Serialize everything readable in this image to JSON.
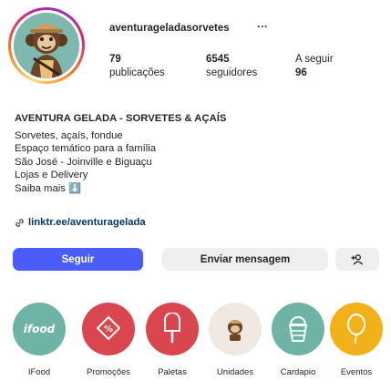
{
  "profile": {
    "username": "aventurageladasorvetes",
    "more_icon": "more-horizontal-icon",
    "stats": {
      "posts": {
        "value": "79",
        "label": "publicações"
      },
      "followers": {
        "value": "6545",
        "label": "seguidores"
      },
      "following": {
        "label": "A seguir",
        "value": "96"
      }
    }
  },
  "bio": {
    "name": "AVENTURA GELADA - SORVETES & AÇAÍS",
    "lines": [
      "Sorvetes, açaís, fondue",
      "Espaço temático para a família",
      "São José - Joinville e Biguaçu",
      "Lojas e Delivery",
      "Saiba mais ⬇️"
    ],
    "link": "linktr.ee/aventuragelada"
  },
  "actions": {
    "follow_label": "Seguir",
    "message_label": "Enviar mensagem",
    "suggest_icon": "add-user-icon"
  },
  "highlights": [
    {
      "label": "IFood",
      "color": "#6fb3a6",
      "icon": "ifood-logo-icon"
    },
    {
      "label": "Promoções",
      "color": "#d9464f",
      "icon": "tag-icon"
    },
    {
      "label": "Paletas",
      "color": "#d9464f",
      "icon": "popsicle-icon"
    },
    {
      "label": "Unidades",
      "color": "#efe9e2",
      "icon": "mascot-icon"
    },
    {
      "label": "Cardapio",
      "color": "#6fb3a6",
      "icon": "menu-cup-icon"
    },
    {
      "label": "Eventos",
      "color": "#f2b119",
      "icon": "balloon-icon"
    }
  ],
  "colors": {
    "accent": "#4a5df9",
    "link": "#00376b",
    "button_gray": "#efefef"
  }
}
